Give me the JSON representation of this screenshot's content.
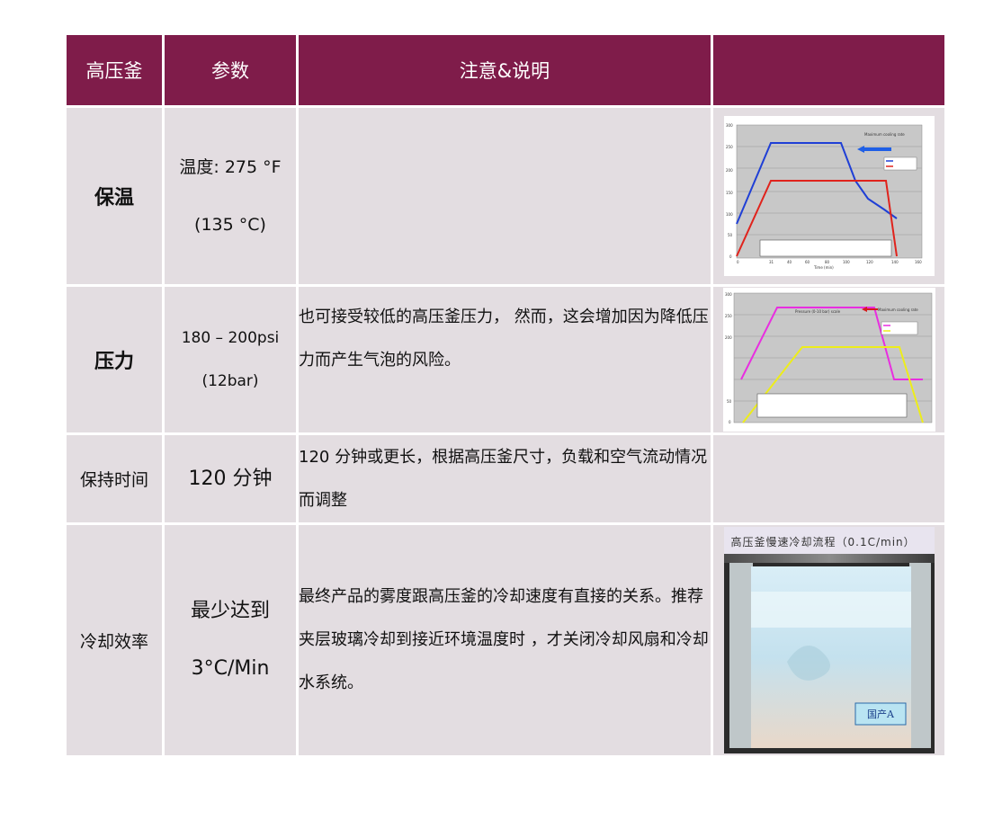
{
  "header": {
    "col1": "高压釜",
    "col2": "参数",
    "col3": "注意&说明",
    "col4": ""
  },
  "rows": [
    {
      "name": "保温",
      "param_line1": "温度: 275 °F",
      "param_line2": "(135 °C)",
      "note": ""
    },
    {
      "name": "压力",
      "param_line1": "180 – 200psi",
      "param_line2": "(12bar)",
      "note": "也可接受较低的高压釜压力， 然而，这会增加因为降低压力而产生气泡的风险。"
    },
    {
      "name": "保持时间",
      "param_line1": "120 分钟",
      "note": "120 分钟或更长，根据高压釜尺寸，负载和空气流动情况而调整"
    },
    {
      "name": "冷却效率",
      "param_line1": "最少达到",
      "param_line2": "3°C/Min",
      "note": "最终产品的雾度跟高压釜的冷却速度有直接的关系。推荐夹层玻璃冷却到接近环境温度时 ，才关闭冷却风扇和冷却水系统。"
    }
  ],
  "photo": {
    "caption": "高压釜慢速冷却流程（0.1C/min）",
    "label": "国产A"
  },
  "colors": {
    "header_bg": "#7f1c4a",
    "cell_bg": "#e3dde1",
    "chart1_temp": "#1f3fd6",
    "chart1_pressure": "#e0231c",
    "chart2_temp": "#e82ee0",
    "chart2_pressure": "#eded1a"
  }
}
